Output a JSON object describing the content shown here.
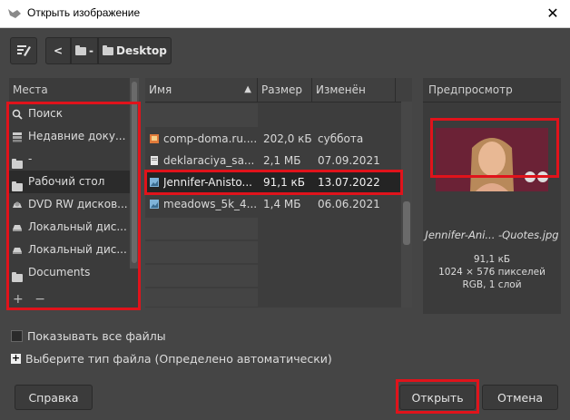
{
  "window": {
    "title": "Открыть изображение",
    "close_label": "✕"
  },
  "path": {
    "back_label": "<",
    "segment1_label": "-",
    "current_label": "Desktop"
  },
  "places": {
    "header": "Места",
    "items": [
      {
        "label": "Поиск",
        "icon": "search-icon"
      },
      {
        "label": "Недавние доку...",
        "icon": "recent-icon"
      },
      {
        "label": "-",
        "icon": "folder-icon"
      },
      {
        "label": "Рабочий стол",
        "icon": "folder-icon"
      },
      {
        "label": "DVD RW дисков...",
        "icon": "dvd-icon"
      },
      {
        "label": "Локальный дис...",
        "icon": "drive-icon"
      },
      {
        "label": "Локальный дис...",
        "icon": "drive-icon"
      },
      {
        "label": "Documents",
        "icon": "folder-icon"
      }
    ],
    "add_label": "+",
    "remove_label": "−"
  },
  "files": {
    "columns": {
      "name": "Имя",
      "size": "Размер",
      "modified": "Изменён"
    },
    "rows": [
      {
        "name": "comp-doma.ru....",
        "size": "202,0 кБ",
        "modified": "суббота"
      },
      {
        "name": "deklaraciya_sa...",
        "size": "2,1 МБ",
        "modified": "07.09.2021"
      },
      {
        "name": "Jennifer-Anisto...",
        "size": "91,1 кБ",
        "modified": "13.07.2022"
      },
      {
        "name": "meadows_5k_4...",
        "size": "1,4 МБ",
        "modified": "06.06.2021"
      }
    ]
  },
  "preview": {
    "header": "Предпросмотр",
    "name": "Jennifer-Ani... -Quotes.jpg",
    "size": "91,1 кБ",
    "dimensions": "1024 × 576 пикселей",
    "mode": "RGB, 1 слой"
  },
  "options": {
    "show_all_files": "Показывать все файлы",
    "file_type": "Выберите тип файла (Определено автоматически)"
  },
  "buttons": {
    "help": "Справка",
    "open": "Открыть",
    "cancel": "Отмена"
  },
  "colors": {
    "highlight_box": "#e0131b",
    "background": "#454545"
  }
}
